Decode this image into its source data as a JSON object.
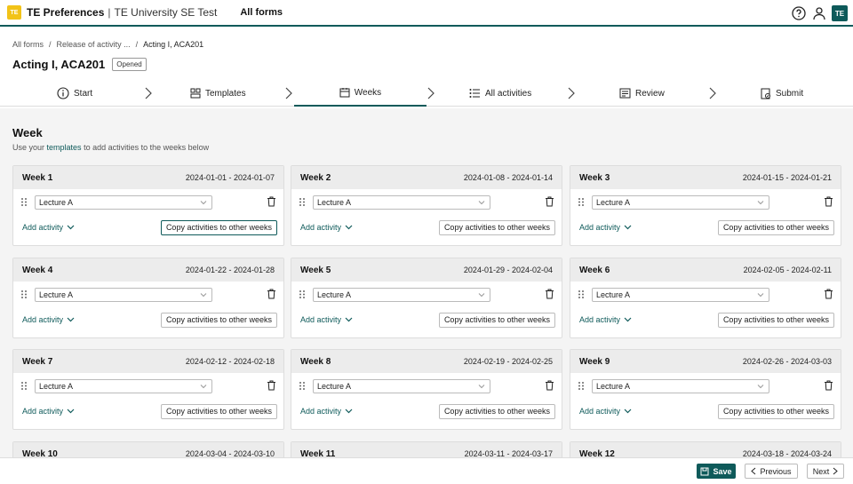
{
  "app": {
    "logo_text": "TE",
    "title": "TE Preferences",
    "separator": "|",
    "subtitle": "TE University SE Test",
    "nav_link": "All forms",
    "avatar": "TE"
  },
  "breadcrumb": {
    "items": [
      "All forms",
      "Release of activity ...",
      "Acting I, ACA201"
    ],
    "separator": "/"
  },
  "page": {
    "title": "Acting I, ACA201",
    "status": "Opened"
  },
  "stepper": {
    "steps": [
      {
        "label": "Start",
        "icon": "info-icon"
      },
      {
        "label": "Templates",
        "icon": "templates-icon"
      },
      {
        "label": "Weeks",
        "icon": "calendar-icon"
      },
      {
        "label": "All activities",
        "icon": "list-icon"
      },
      {
        "label": "Review",
        "icon": "review-icon"
      },
      {
        "label": "Submit",
        "icon": "submit-icon"
      }
    ],
    "active_index": 2
  },
  "content": {
    "heading": "Week",
    "sub_before": "Use your",
    "sub_link": "templates",
    "sub_after": "to add activities to the weeks below"
  },
  "weeks": [
    {
      "title": "Week 1",
      "dates": "2024-01-01 - 2024-01-07",
      "activity": "Lecture A"
    },
    {
      "title": "Week 2",
      "dates": "2024-01-08 - 2024-01-14",
      "activity": "Lecture A"
    },
    {
      "title": "Week 3",
      "dates": "2024-01-15 - 2024-01-21",
      "activity": "Lecture A"
    },
    {
      "title": "Week 4",
      "dates": "2024-01-22 - 2024-01-28",
      "activity": "Lecture A"
    },
    {
      "title": "Week 5",
      "dates": "2024-01-29 - 2024-02-04",
      "activity": "Lecture A"
    },
    {
      "title": "Week 6",
      "dates": "2024-02-05 - 2024-02-11",
      "activity": "Lecture A"
    },
    {
      "title": "Week 7",
      "dates": "2024-02-12 - 2024-02-18",
      "activity": "Lecture A"
    },
    {
      "title": "Week 8",
      "dates": "2024-02-19 - 2024-02-25",
      "activity": "Lecture A"
    },
    {
      "title": "Week 9",
      "dates": "2024-02-26 - 2024-03-03",
      "activity": "Lecture A"
    },
    {
      "title": "Week 10",
      "dates": "2024-03-04 - 2024-03-10"
    },
    {
      "title": "Week 11",
      "dates": "2024-03-11 - 2024-03-17"
    },
    {
      "title": "Week 12",
      "dates": "2024-03-18 - 2024-03-24"
    }
  ],
  "card_labels": {
    "add_activity": "Add activity",
    "copy": "Copy activities to other weeks"
  },
  "footer": {
    "save": "Save",
    "previous": "Previous",
    "next": "Next"
  },
  "colors": {
    "brand": "#0e5a5a",
    "logo": "#f2c318"
  }
}
